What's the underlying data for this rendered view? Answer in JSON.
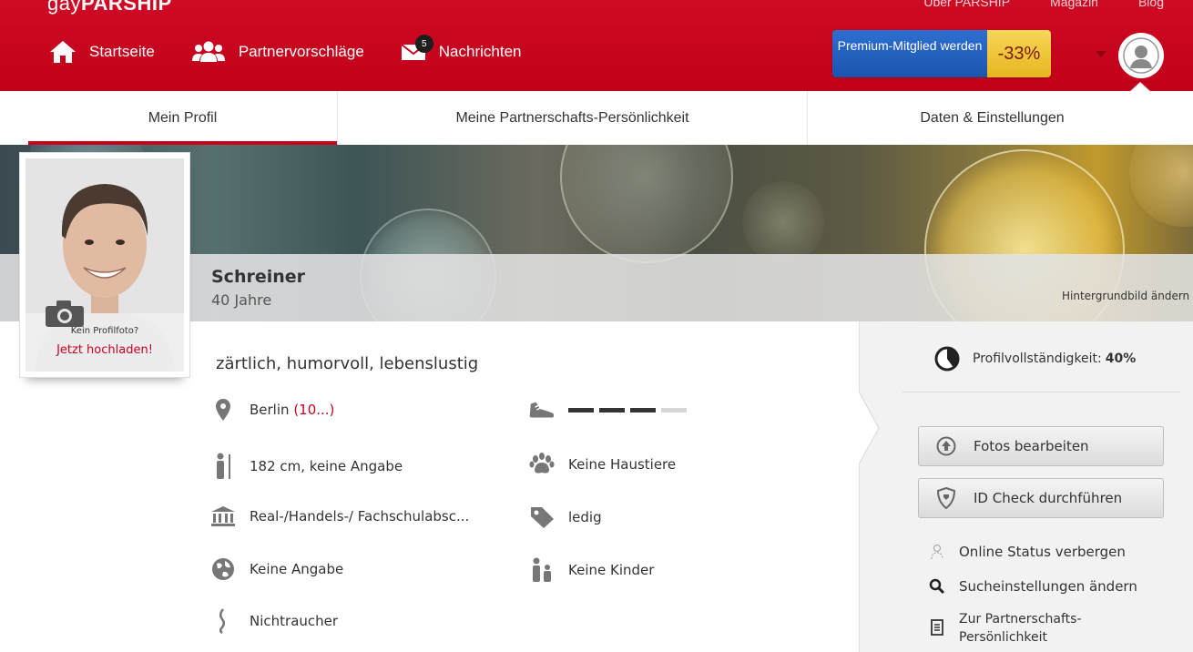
{
  "brand": {
    "prefix": "gay",
    "name": "PARSHIP"
  },
  "top_links": [
    "Über PARSHIP",
    "Magazin",
    "Blog"
  ],
  "nav": {
    "home": "Startseite",
    "suggestions": "Partnervorschläge",
    "messages": "Nachrichten",
    "messages_badge": "5"
  },
  "premium": {
    "label": "Premium-Mitglied werden",
    "discount": "-33%"
  },
  "tabs": {
    "profile": "Mein Profil",
    "personality": "Meine Partnerschafts-Persönlichkeit",
    "settings": "Daten & Einstellungen"
  },
  "profile": {
    "name": "Schreiner",
    "age": "40 Jahre",
    "bg_change": "Hintergrundbild ändern",
    "no_photo": "Kein Profilfoto?",
    "upload": "Jetzt hochladen!",
    "tagline": "zärtlich, humorvoll, lebenslustig"
  },
  "details": {
    "location_city": "Berlin",
    "location_code": "(10...)",
    "height": "182 cm,  keine Angabe",
    "education": "Real-/Handels-/ Fachschulabsc...",
    "religion": "Keine Angabe",
    "smoking": "Nichtraucher",
    "sport_level": 3,
    "sport_max": 4,
    "pets": "Keine Haustiere",
    "status": "ledig",
    "children": "Keine Kinder"
  },
  "sidebar": {
    "completeness_label": "Profilvollständigkeit:",
    "completeness_value": "40%",
    "edit_photos": "Fotos bearbeiten",
    "id_check": "ID Check durchführen",
    "hide_online": "Online Status verbergen",
    "search_settings": "Sucheinstellungen ändern",
    "to_personality_1": "Zur Partnerschafts-",
    "to_personality_2": "Persönlichkeit"
  },
  "colors": {
    "brand_red": "#c8001e",
    "premium_blue": "#1f5bb8",
    "premium_gold": "#f0c63a"
  }
}
